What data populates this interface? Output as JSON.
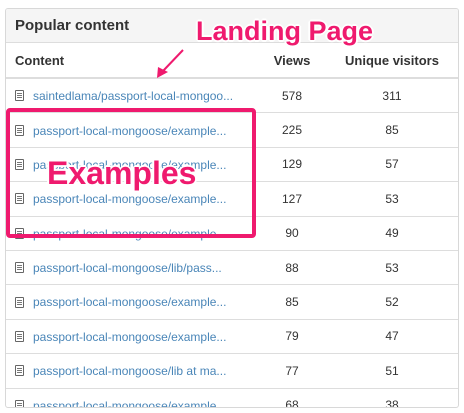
{
  "panel": {
    "title": "Popular content"
  },
  "table": {
    "columns": [
      "Content",
      "Views",
      "Unique visitors"
    ],
    "rows": [
      {
        "content": "saintedlama/passport-local-mongoo...",
        "views": "578",
        "unique": "311"
      },
      {
        "content": "passport-local-mongoose/example...",
        "views": "225",
        "unique": "85"
      },
      {
        "content": "passport-local-mongoose/example...",
        "views": "129",
        "unique": "57"
      },
      {
        "content": "passport-local-mongoose/example...",
        "views": "127",
        "unique": "53"
      },
      {
        "content": "passport-local-mongoose/example...",
        "views": "90",
        "unique": "49"
      },
      {
        "content": "passport-local-mongoose/lib/pass...",
        "views": "88",
        "unique": "53"
      },
      {
        "content": "passport-local-mongoose/example...",
        "views": "85",
        "unique": "52"
      },
      {
        "content": "passport-local-mongoose/example...",
        "views": "79",
        "unique": "47"
      },
      {
        "content": "passport-local-mongoose/lib at ma...",
        "views": "77",
        "unique": "51"
      },
      {
        "content": "passport-local-mongoose/example...",
        "views": "68",
        "unique": "38"
      }
    ]
  },
  "annotations": {
    "landing_label": "Landing Page",
    "examples_label": "Examples",
    "color": "#ef1a6e"
  },
  "icons": {
    "row_icon": "document-icon",
    "arrow": "arrow-icon"
  }
}
